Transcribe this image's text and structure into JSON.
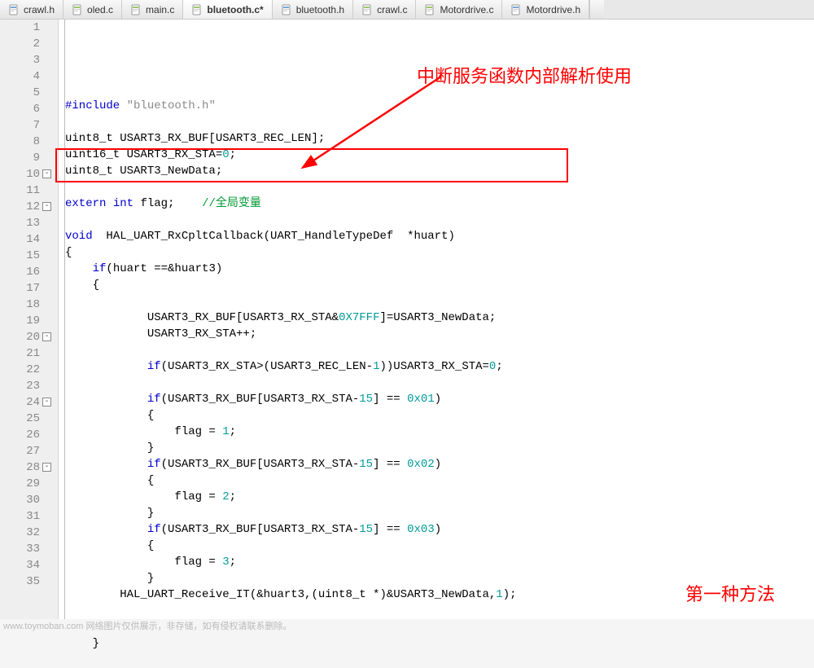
{
  "tabs": [
    {
      "label": "crawl.h"
    },
    {
      "label": "oled.c"
    },
    {
      "label": "main.c"
    },
    {
      "label": "bluetooth.c*",
      "active": true
    },
    {
      "label": "bluetooth.h"
    },
    {
      "label": "crawl.c"
    },
    {
      "label": "Motordrive.c"
    },
    {
      "label": "Motordrive.h"
    }
  ],
  "annotations": {
    "top": "中断服务函数内部解析使用",
    "bottom": "第一种方法"
  },
  "footer": "www.toymoban.com 网络图片仅供展示，非存储，如有侵权请联系删除。",
  "code": {
    "lines": [
      {
        "n": 1,
        "seg": [
          {
            "t": "#include ",
            "c": "kw"
          },
          {
            "t": "\"bluetooth.h\"",
            "c": "str"
          }
        ]
      },
      {
        "n": 2,
        "seg": []
      },
      {
        "n": 3,
        "seg": [
          {
            "t": "uint8_t USART3_RX_BUF[USART3_REC_LEN];"
          }
        ]
      },
      {
        "n": 4,
        "seg": [
          {
            "t": "uint16_t USART3_RX_STA="
          },
          {
            "t": "0",
            "c": "num"
          },
          {
            "t": ";"
          }
        ]
      },
      {
        "n": 5,
        "seg": [
          {
            "t": "uint8_t USART3_NewData;"
          }
        ]
      },
      {
        "n": 6,
        "seg": []
      },
      {
        "n": 7,
        "seg": [
          {
            "t": "extern",
            "c": "kw"
          },
          {
            "t": " "
          },
          {
            "t": "int",
            "c": "kw"
          },
          {
            "t": " flag;    "
          },
          {
            "t": "//全局变量",
            "c": "cmt"
          }
        ]
      },
      {
        "n": 8,
        "seg": []
      },
      {
        "n": 9,
        "seg": [
          {
            "t": "void",
            "c": "kw"
          },
          {
            "t": "  HAL_UART_RxCpltCallback(UART_HandleTypeDef  *huart)"
          }
        ]
      },
      {
        "n": 10,
        "fold": "open",
        "seg": [
          {
            "t": "{"
          }
        ]
      },
      {
        "n": 11,
        "seg": [
          {
            "t": "    "
          },
          {
            "t": "if",
            "c": "kw"
          },
          {
            "t": "(huart ==&huart3)"
          }
        ]
      },
      {
        "n": 12,
        "fold": "open",
        "seg": [
          {
            "t": "    {"
          }
        ]
      },
      {
        "n": 13,
        "seg": []
      },
      {
        "n": 14,
        "seg": [
          {
            "t": "            USART3_RX_BUF[USART3_RX_STA&"
          },
          {
            "t": "0X7FFF",
            "c": "hexg"
          },
          {
            "t": "]=USART3_NewData;"
          }
        ]
      },
      {
        "n": 15,
        "seg": [
          {
            "t": "            USART3_RX_STA++;"
          }
        ]
      },
      {
        "n": 16,
        "seg": []
      },
      {
        "n": 17,
        "seg": [
          {
            "t": "            "
          },
          {
            "t": "if",
            "c": "kw"
          },
          {
            "t": "(USART3_RX_STA>(USART3_REC_LEN-"
          },
          {
            "t": "1",
            "c": "num"
          },
          {
            "t": "))USART3_RX_STA="
          },
          {
            "t": "0",
            "c": "num"
          },
          {
            "t": ";"
          }
        ]
      },
      {
        "n": 18,
        "seg": []
      },
      {
        "n": 19,
        "seg": [
          {
            "t": "            "
          },
          {
            "t": "if",
            "c": "kw"
          },
          {
            "t": "(USART3_RX_BUF[USART3_RX_STA-"
          },
          {
            "t": "15",
            "c": "num"
          },
          {
            "t": "] == "
          },
          {
            "t": "0x01",
            "c": "num"
          },
          {
            "t": ")"
          }
        ]
      },
      {
        "n": 20,
        "fold": "open",
        "seg": [
          {
            "t": "            {"
          }
        ]
      },
      {
        "n": 21,
        "seg": [
          {
            "t": "                flag = "
          },
          {
            "t": "1",
            "c": "num"
          },
          {
            "t": ";"
          }
        ]
      },
      {
        "n": 22,
        "seg": [
          {
            "t": "            }"
          }
        ]
      },
      {
        "n": 23,
        "seg": [
          {
            "t": "            "
          },
          {
            "t": "if",
            "c": "kw"
          },
          {
            "t": "(USART3_RX_BUF[USART3_RX_STA-"
          },
          {
            "t": "15",
            "c": "num"
          },
          {
            "t": "] == "
          },
          {
            "t": "0x02",
            "c": "num"
          },
          {
            "t": ")"
          }
        ]
      },
      {
        "n": 24,
        "fold": "open",
        "seg": [
          {
            "t": "            {"
          }
        ]
      },
      {
        "n": 25,
        "seg": [
          {
            "t": "                flag = "
          },
          {
            "t": "2",
            "c": "num"
          },
          {
            "t": ";"
          }
        ]
      },
      {
        "n": 26,
        "seg": [
          {
            "t": "            }"
          }
        ]
      },
      {
        "n": 27,
        "seg": [
          {
            "t": "            "
          },
          {
            "t": "if",
            "c": "kw"
          },
          {
            "t": "(USART3_RX_BUF[USART3_RX_STA-"
          },
          {
            "t": "15",
            "c": "num"
          },
          {
            "t": "] == "
          },
          {
            "t": "0x03",
            "c": "num"
          },
          {
            "t": ")"
          }
        ]
      },
      {
        "n": 28,
        "fold": "open",
        "seg": [
          {
            "t": "            {"
          }
        ]
      },
      {
        "n": 29,
        "seg": [
          {
            "t": "                flag = "
          },
          {
            "t": "3",
            "c": "num"
          },
          {
            "t": ";"
          }
        ]
      },
      {
        "n": 30,
        "seg": [
          {
            "t": "            }"
          }
        ]
      },
      {
        "n": 31,
        "seg": [
          {
            "t": "        HAL_UART_Receive_IT(&huart3,(uint8_t *)&USART3_NewData,"
          },
          {
            "t": "1",
            "c": "num"
          },
          {
            "t": ");"
          }
        ]
      },
      {
        "n": 32,
        "seg": []
      },
      {
        "n": 33,
        "seg": []
      },
      {
        "n": 34,
        "seg": [
          {
            "t": "    }"
          }
        ]
      },
      {
        "n": 35,
        "seg": []
      }
    ]
  }
}
